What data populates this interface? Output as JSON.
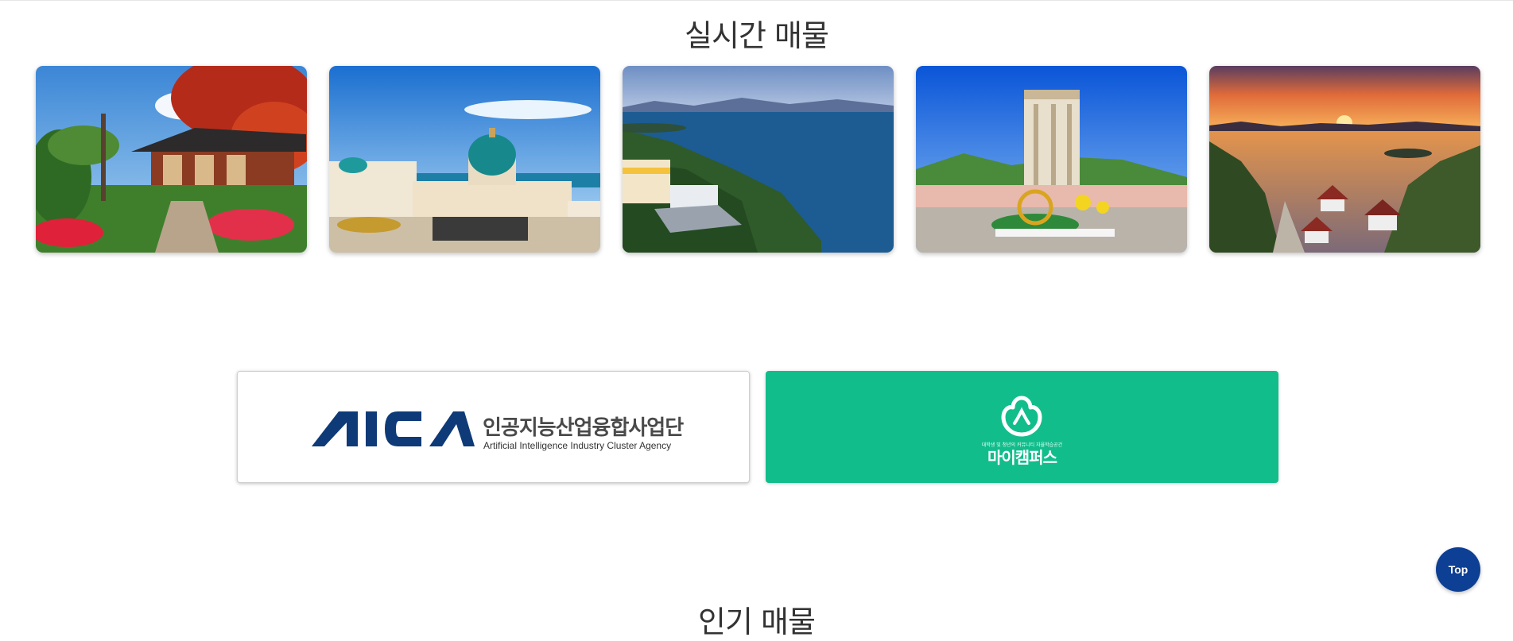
{
  "sections": {
    "realtime_title": "실시간 매물",
    "popular_title": "인기 매물"
  },
  "listings": [
    {
      "scene": "hanok-garden-autumn",
      "accent": "#c9321d"
    },
    {
      "scene": "domed-resort-seaside",
      "accent": "#1e7f86"
    },
    {
      "scene": "coastal-cliff-resort",
      "accent": "#1d5c8a"
    },
    {
      "scene": "tower-hotel-plaza",
      "accent": "#2b7bd6"
    },
    {
      "scene": "sunset-bay-village",
      "accent": "#f08a2a"
    }
  ],
  "partners": {
    "aica": {
      "logo_text": "AICA",
      "name_ko": "인공지능산업융합사업단",
      "name_en": "Artificial Intelligence Industry Cluster Agency",
      "color": "#0e3a78"
    },
    "mycampus": {
      "tagline": "대학생 및 청년의 커뮤니티 자율학습공간",
      "name": "마이캠퍼스",
      "color": "#12bd8c"
    }
  },
  "top_button": {
    "label": "Top",
    "color": "#0d3f94"
  }
}
